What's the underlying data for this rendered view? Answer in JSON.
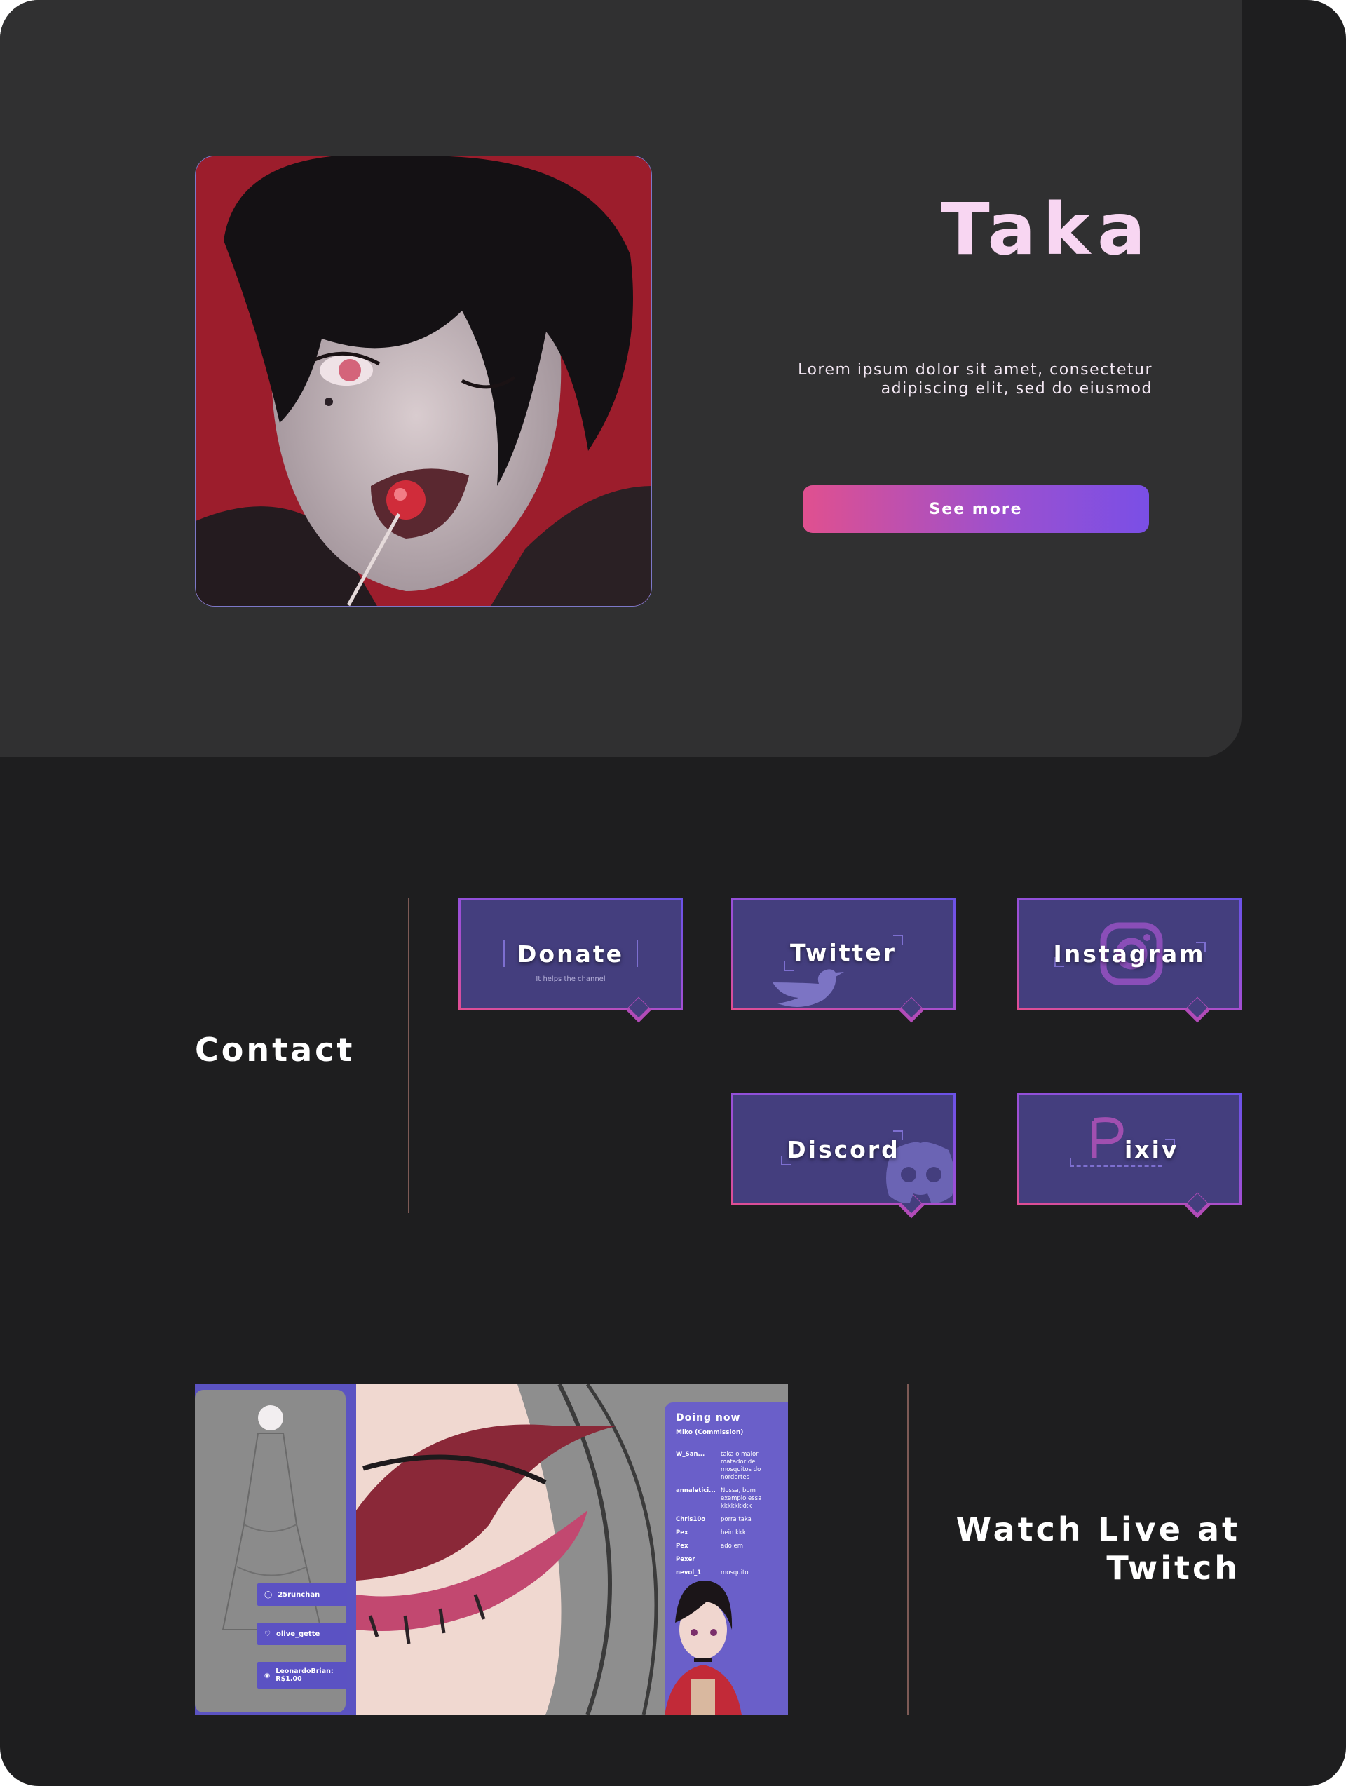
{
  "hero": {
    "title": "Taka",
    "description": "Lorem ipsum dolor sit amet, consectetur adipiscing elit, sed do eiusmod",
    "see_more_label": "See more"
  },
  "contact": {
    "title": "Contact",
    "cards": [
      {
        "label": "Donate",
        "sub": "It helps the channel",
        "icon": "donate"
      },
      {
        "label": "Twitter",
        "icon": "twitter-bird-icon"
      },
      {
        "label": "Instagram",
        "icon": "instagram-icon"
      },
      {
        "label": "Discord",
        "icon": "discord-icon"
      },
      {
        "label": "ixiv",
        "icon": "pixiv-p-icon"
      }
    ]
  },
  "twitch": {
    "title_line1": "Watch Live at",
    "title_line2": "Twitch",
    "chat_title": "Doing now",
    "chat_sub": "Miko (Commission)",
    "chat_lines": [
      {
        "user": "W_San...",
        "msg": "taka o maior matador de mosquitos do nordertes"
      },
      {
        "user": "annaletici...",
        "msg": "Nossa, bom exemplo essa kkkkkkkkk"
      },
      {
        "user": "Chris10o",
        "msg": "porra taka"
      },
      {
        "user": "Pex",
        "msg": "hein kkk"
      },
      {
        "user": "Pex",
        "msg": "ado em"
      },
      {
        "user": "Pexer",
        "msg": ""
      },
      {
        "user": "nevol_1",
        "msg": "mosquito"
      }
    ],
    "alerts": [
      {
        "text": "25runchan",
        "icon": "follow-icon"
      },
      {
        "text": "olive_gette",
        "icon": "heart-icon"
      },
      {
        "text": "LeonardoBrian: R$1.00",
        "icon": "coin-icon"
      }
    ]
  },
  "colors": {
    "page_bg": "#1e1e1f",
    "hero_bg": "#303031",
    "title_pink": "#f8d6f2",
    "card_bg": "#443e7e",
    "gradient_pink": "#e24e92",
    "gradient_purple": "#6a52e8"
  }
}
